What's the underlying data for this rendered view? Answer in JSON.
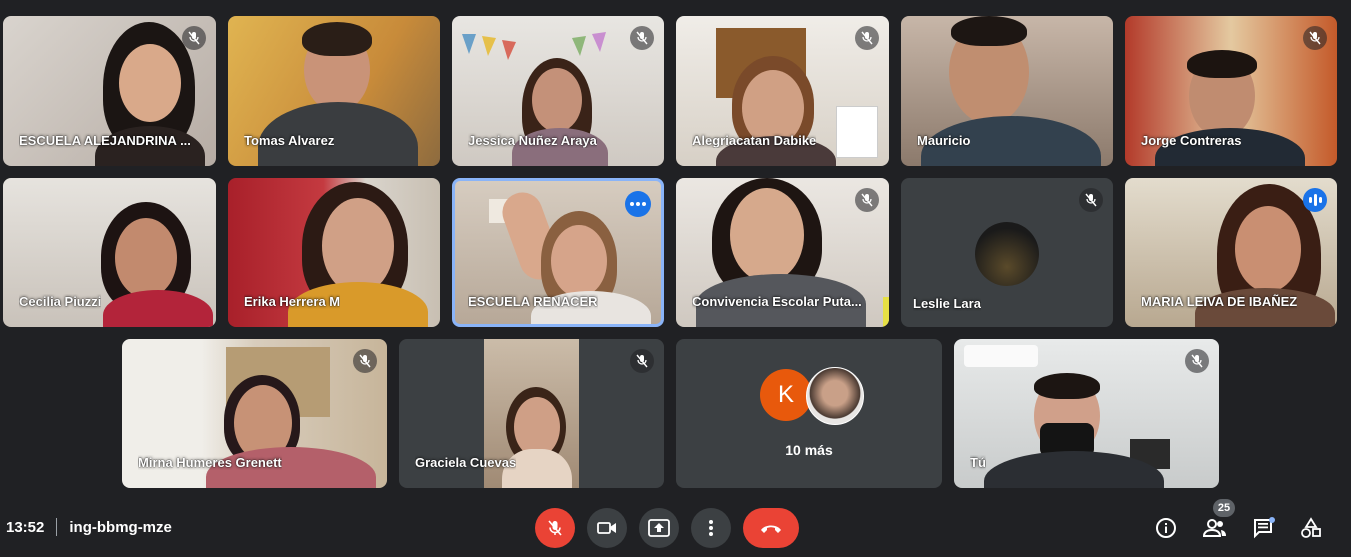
{
  "meeting": {
    "time": "13:52",
    "code": "ing-bbmg-mze"
  },
  "participants": [
    {
      "name": "ESCUELA ALEJANDRINA ...",
      "mic": "muted"
    },
    {
      "name": "Tomas Alvarez",
      "mic": "none"
    },
    {
      "name": "Jessica Nuñez Araya",
      "mic": "muted"
    },
    {
      "name": "Alegriacatan Dabike",
      "mic": "muted"
    },
    {
      "name": "Mauricio",
      "mic": "none"
    },
    {
      "name": "Jorge Contreras",
      "mic": "muted"
    },
    {
      "name": "Cecilia Piuzzi",
      "mic": "none"
    },
    {
      "name": "Erika Herrera M",
      "mic": "none"
    },
    {
      "name": "ESCUELA RENACER",
      "mic": "more-options"
    },
    {
      "name": "Convivencia Escolar Puta...",
      "mic": "muted"
    },
    {
      "name": "Leslie Lara",
      "mic": "muted"
    },
    {
      "name": "MARIA LEIVA DE IBAÑEZ",
      "mic": "speaking"
    },
    {
      "name": "Mirna Humeres Grenett",
      "mic": "muted"
    },
    {
      "name": "Graciela Cuevas",
      "mic": "muted"
    },
    {
      "name": "Tú",
      "mic": "muted"
    }
  ],
  "overflow": {
    "label": "10 más",
    "avatar_initial": "K"
  },
  "participant_count": "25",
  "colors": {
    "background": "#202124",
    "tile": "#3c4043",
    "accent": "#8ab4f8",
    "danger": "#ea4335",
    "button": "#3c4043"
  },
  "icons": [
    "mic-off-icon",
    "camera-icon",
    "present-icon",
    "more-vert-icon",
    "call-end-icon",
    "info-icon",
    "people-icon",
    "chat-icon",
    "activities-icon"
  ]
}
